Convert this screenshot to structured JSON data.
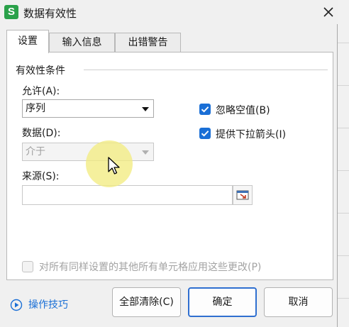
{
  "dialog": {
    "title": "数据有效性",
    "app_icon_letter": "S",
    "close_icon": "close-icon"
  },
  "tabs": [
    {
      "label": "设置",
      "active": true
    },
    {
      "label": "输入信息",
      "active": false
    },
    {
      "label": "出错警告",
      "active": false
    }
  ],
  "validation_criteria": {
    "group_label": "有效性条件",
    "allow_label": "允许(A):",
    "allow_value": "序列",
    "data_label": "数据(D):",
    "data_value": "介于",
    "ignore_blank_label": "忽略空值(B)",
    "ignore_blank_checked": true,
    "dropdown_label": "提供下拉箭头(I)",
    "dropdown_checked": true,
    "source_label": "来源(S):",
    "source_value": ""
  },
  "apply_all": {
    "label": "对所有同样设置的其他所有单元格应用这些更改(P)",
    "checked": false
  },
  "footer": {
    "help_label": "操作技巧",
    "clear_all_label": "全部清除(C)",
    "ok_label": "确定",
    "cancel_label": "取消"
  },
  "colors": {
    "accent": "#1a6fd6",
    "app_icon": "#2aa14a",
    "cursor_highlight": "#f2ec82"
  }
}
